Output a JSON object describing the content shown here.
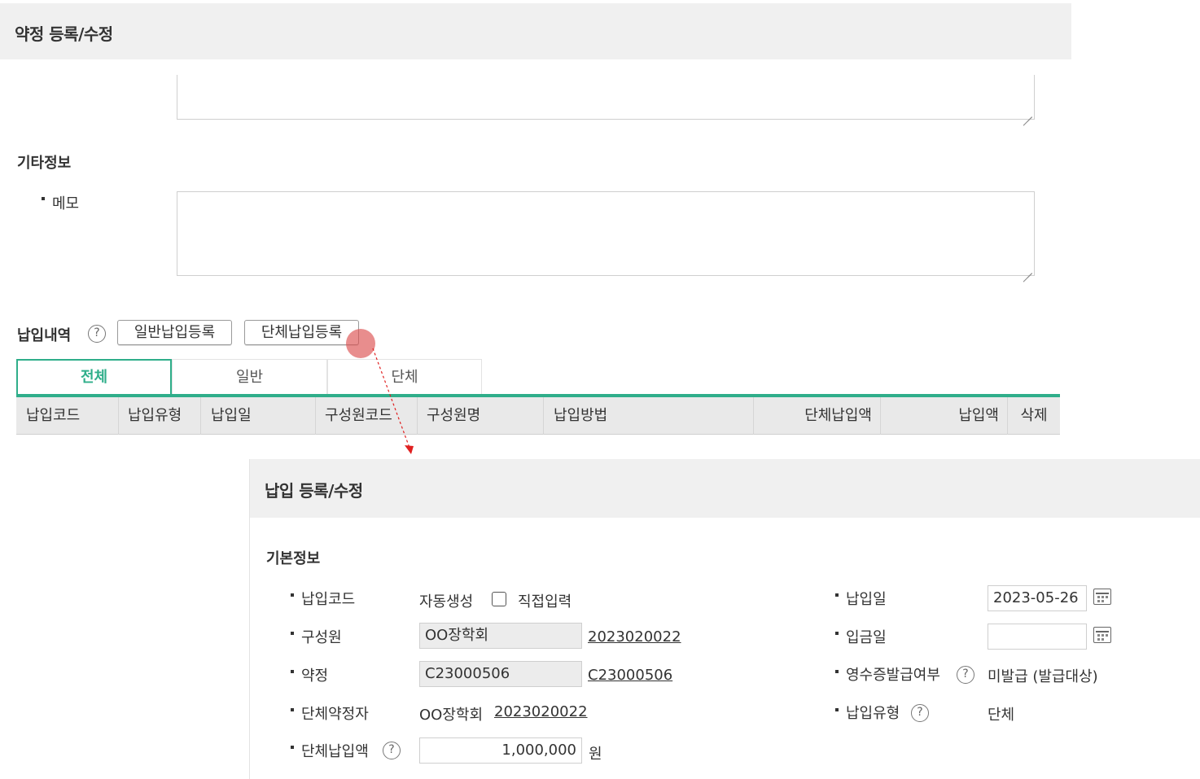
{
  "agreement_panel": {
    "title": "약정 등록/수정",
    "other_info": {
      "section_title": "기타정보",
      "memo_label": "메모"
    },
    "payments": {
      "section_title": "납입내역",
      "help_icon": "?",
      "buttons": {
        "general_register": "일반납입등록",
        "group_register": "단체납입등록"
      },
      "tabs": [
        "전체",
        "일반",
        "단체"
      ],
      "columns": [
        "납입코드",
        "납입유형",
        "납입일",
        "구성원코드",
        "구성원명",
        "납입방법",
        "단체납입액",
        "납입액",
        "삭제"
      ]
    }
  },
  "payment_panel": {
    "title": "납입 등록/수정",
    "section_title": "기본정보",
    "left_fields": {
      "payment_code": {
        "label": "납입코드",
        "auto_text": "자동생성",
        "manual_text": "직접입력"
      },
      "member": {
        "label": "구성원",
        "value": "OO장학회",
        "link": "2023020022"
      },
      "agreement": {
        "label": "약정",
        "value": "C23000506",
        "link": "C23000506"
      },
      "group_contractor": {
        "label": "단체약정자",
        "value": "OO장학회",
        "link": "2023020022"
      },
      "group_amount": {
        "label": "단체납입액",
        "value": "1,000,000",
        "unit": "원"
      }
    },
    "right_fields": {
      "payment_date": {
        "label": "납입일",
        "value": "2023-05-26"
      },
      "deposit_date": {
        "label": "입금일",
        "value": ""
      },
      "receipt": {
        "label": "영수증발급여부",
        "value": "미발급 (발급대상)"
      },
      "payment_type": {
        "label": "납입유형",
        "value": "단체"
      }
    }
  },
  "colors": {
    "accent": "#2fae8a",
    "cursor": "#dc5050",
    "arrow": "#e02020"
  },
  "icons": [
    "help-icon",
    "calendar-icon",
    "resize-grip-icon",
    "checkbox"
  ]
}
